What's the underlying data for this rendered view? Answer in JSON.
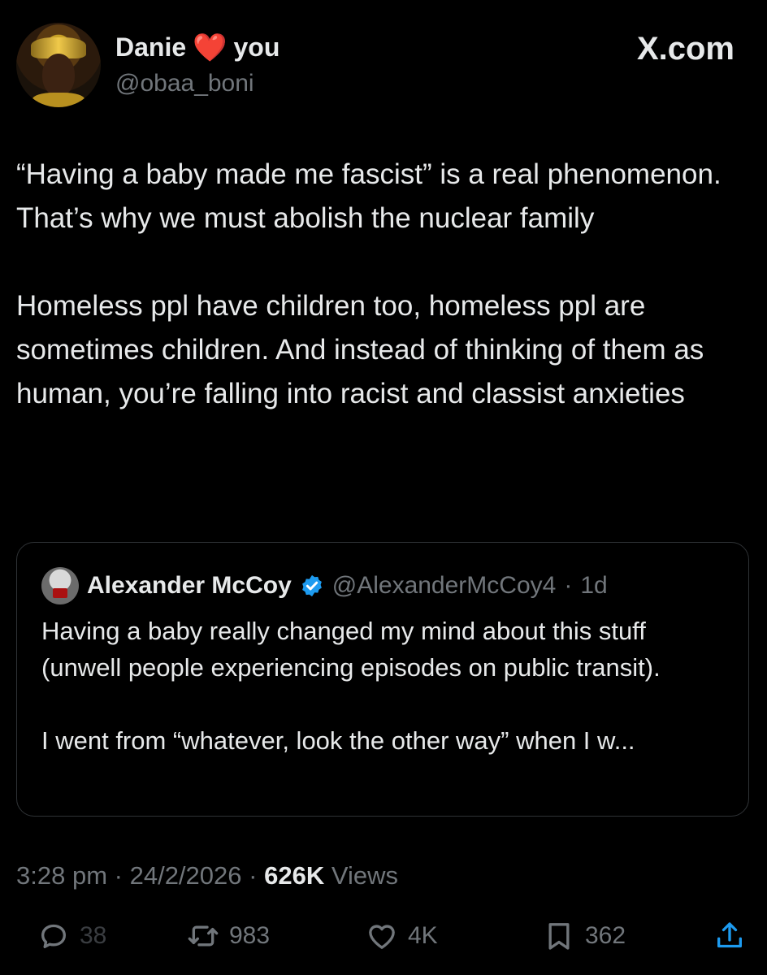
{
  "author": {
    "display_name": "Danie",
    "name_suffix": "you",
    "heart_emoji": "❤️",
    "handle": "@obaa_boni"
  },
  "brand": "X.com",
  "tweet": {
    "paragraphs": [
      "“Having a baby made me fascist” is a real phenomenon. That’s why we must abolish the nuclear family",
      "Homeless ppl have children too, homeless ppl are sometimes children. And instead of thinking of them as human, you’re falling into racist and classist anxieties"
    ]
  },
  "quoted_tweet": {
    "display_name": "Alexander McCoy",
    "handle": "@AlexanderMcCoy4",
    "separator": "·",
    "age": "1d",
    "paragraphs": [
      "Having a baby really changed my mind about this stuff (unwell people experiencing episodes on public transit).",
      "I went from “whatever, look the other way” when I w..."
    ]
  },
  "meta": {
    "time": "3:28 pm",
    "separator": "·",
    "date": "24/2/2026",
    "views_count": "626K",
    "views_label": "Views"
  },
  "actions": {
    "replies": "38",
    "reposts": "983",
    "likes": "4K",
    "bookmarks": "362"
  },
  "colors": {
    "background": "#000000",
    "text": "#e7e9ea",
    "muted": "#71767b",
    "border": "#2f3336",
    "verified": "#1d9bf0",
    "heart": "#f4212e"
  },
  "icons": [
    "avatar",
    "heart-emoji",
    "verified-badge-icon",
    "reply-icon",
    "repost-icon",
    "like-icon",
    "bookmark-icon",
    "share-icon"
  ]
}
